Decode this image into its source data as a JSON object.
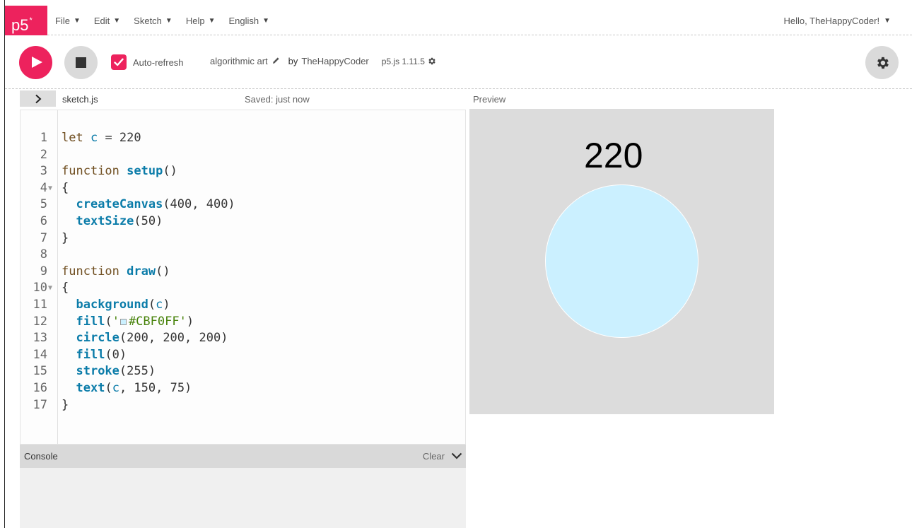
{
  "nav": {
    "logo": "p5",
    "logo_sup": "*",
    "menu": [
      {
        "label": "File",
        "caret": "▼"
      },
      {
        "label": "Edit",
        "caret": "▼"
      },
      {
        "label": "Sketch",
        "caret": "▼"
      },
      {
        "label": "Help",
        "caret": "▼"
      },
      {
        "label": "English",
        "caret": "▼"
      }
    ],
    "user": "Hello, TheHappyCoder!",
    "user_caret": "▼"
  },
  "toolbar": {
    "autorefresh_label": "Auto-refresh",
    "autorefresh_checked": true,
    "project_name": "algorithmic art",
    "by": "by",
    "owner": "TheHappyCoder",
    "version": "p5.js 1.11.5",
    "accent_color": "#ED225D"
  },
  "editor": {
    "filename": "sketch.js",
    "saved_status": "Saved: just now",
    "lines": [
      {
        "n": "1"
      },
      {
        "n": "2"
      },
      {
        "n": "3"
      },
      {
        "n": "4"
      },
      {
        "n": "5"
      },
      {
        "n": "6"
      },
      {
        "n": "7"
      },
      {
        "n": "8"
      },
      {
        "n": "9"
      },
      {
        "n": "10"
      },
      {
        "n": "11"
      },
      {
        "n": "12"
      },
      {
        "n": "13"
      },
      {
        "n": "14"
      },
      {
        "n": "15"
      },
      {
        "n": "16"
      },
      {
        "n": "17"
      }
    ],
    "code": {
      "l1_kw": "let",
      "l1_var": "c",
      "l1_rest": " = 220",
      "l3_kw": "function",
      "l3_fn": "setup",
      "l3_rest": "()",
      "l4": "{",
      "l5_fn": "createCanvas",
      "l5_rest": "(400, 400)",
      "l6_fn": "textSize",
      "l6_rest": "(50)",
      "l7": "}",
      "l9_kw": "function",
      "l9_fn": "draw",
      "l9_rest": "()",
      "l10": "{",
      "l11_fn": "background",
      "l11_open": "(",
      "l11_var": "c",
      "l11_close": ")",
      "l12_fn": "fill",
      "l12_open": "(",
      "l12_str1": "'",
      "l12_str2": "#CBF0FF'",
      "l12_close": ")",
      "l13_fn": "circle",
      "l13_rest": "(200, 200, 200)",
      "l14_fn": "fill",
      "l14_rest": "(0)",
      "l15_fn": "stroke",
      "l15_rest": "(255)",
      "l16_fn": "text",
      "l16_open": "(",
      "l16_var": "c",
      "l16_rest": ", 150, 75)",
      "l17": "}"
    }
  },
  "console": {
    "title": "Console",
    "clear_label": "Clear"
  },
  "preview": {
    "label": "Preview",
    "canvas_text": "220",
    "background_color": "#DCDCDC",
    "circle_color": "#CBF0FF"
  }
}
